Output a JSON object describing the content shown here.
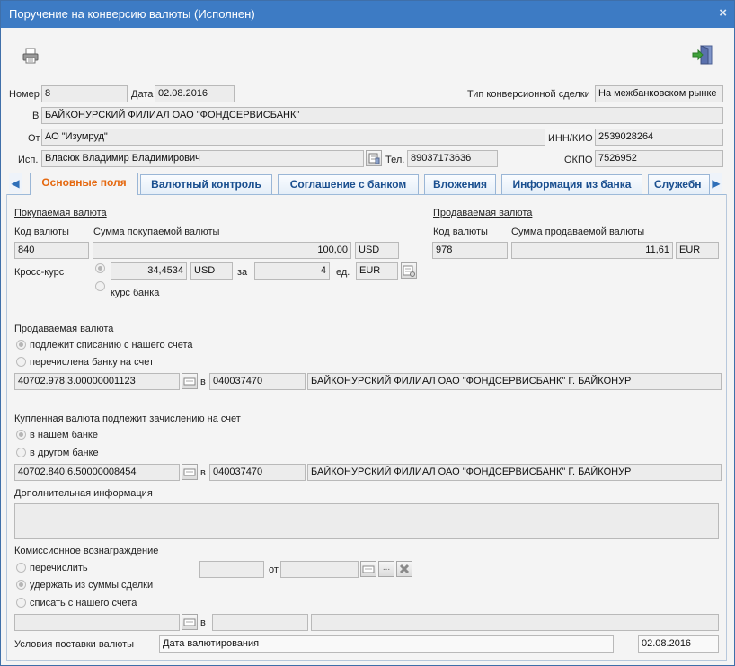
{
  "window": {
    "title": "Поручение на конверсию валюты (Исполнен)",
    "close": "×"
  },
  "header": {
    "number_label": "Номер",
    "number": "8",
    "date_label": "Дата",
    "date": "02.08.2016",
    "deal_type_label": "Тип конверсионной сделки",
    "deal_type": "На межбанковском рынке",
    "bank_label": "В",
    "bank": "БАЙКОНУРСКИЙ ФИЛИАЛ ОАО \"ФОНДСЕРВИСБАНК\"",
    "from_label": "От",
    "from": "АО \"Изумруд\"",
    "inn_label": "ИНН/КИО",
    "inn": "2539028264",
    "executor_label": "Исп.",
    "executor": "Власюк Владимир Владимирович",
    "phone_label": "Тел.",
    "phone": "89037173636",
    "okpo_label": "ОКПО",
    "okpo": "7526952"
  },
  "tabs": [
    "Основные поля",
    "Валютный контроль",
    "Соглашение с банком",
    "Вложения",
    "Информация из банка",
    "Служебн"
  ],
  "buy": {
    "heading": "Покупаемая валюта",
    "code_label": "Код валюты",
    "code": "840",
    "sum_label": "Сумма покупаемой валюты",
    "sum": "100,00",
    "currency": "USD",
    "cross_label": "Кросс-курс",
    "rate": "34,4534",
    "rate_currency": "USD",
    "za_label": "за",
    "units": "4",
    "units_label": "ед.",
    "units_currency": "EUR",
    "bank_rate_label": "курс банка"
  },
  "sell": {
    "heading": "Продаваемая валюта",
    "code_label": "Код валюты",
    "code": "978",
    "sum_label": "Сумма продаваемой валюты",
    "sum": "11,61",
    "currency": "EUR"
  },
  "sold_section": {
    "title": "Продаваемая валюта",
    "option1": "подлежит списанию с нашего счета",
    "option2": "перечислена банку на счет",
    "account": "40702.978.3.00000001123",
    "in_label": "в",
    "bik": "040037470",
    "bank": "БАЙКОНУРСКИЙ ФИЛИАЛ ОАО \"ФОНДСЕРВИСБАНК\" Г. БАЙКОНУР"
  },
  "bought_section": {
    "title": "Купленная валюта подлежит зачислению на счет",
    "option1": "в нашем банке",
    "option2": "в другом банке",
    "account": "40702.840.6.50000008454",
    "in_label": "в",
    "bik": "040037470",
    "bank": "БАЙКОНУРСКИЙ ФИЛИАЛ ОАО \"ФОНДСЕРВИСБАНК\" Г. БАЙКОНУР"
  },
  "additional": {
    "label": "Дополнительная информация",
    "value": ""
  },
  "commission": {
    "title": "Комиссионное вознаграждение",
    "option1": "перечислить",
    "option2": "удержать из суммы сделки",
    "option3": "списать с нашего счета",
    "from_label": "от",
    "in_label": "в",
    "ellipsis": "..."
  },
  "delivery": {
    "label": "Условия поставки валюты",
    "type": "Дата валютирования",
    "date": "02.08.2016"
  },
  "colors": {
    "titlebar": "#3d7bc4",
    "active_tab": "#e5680f",
    "tab_text": "#1a4f8f"
  }
}
